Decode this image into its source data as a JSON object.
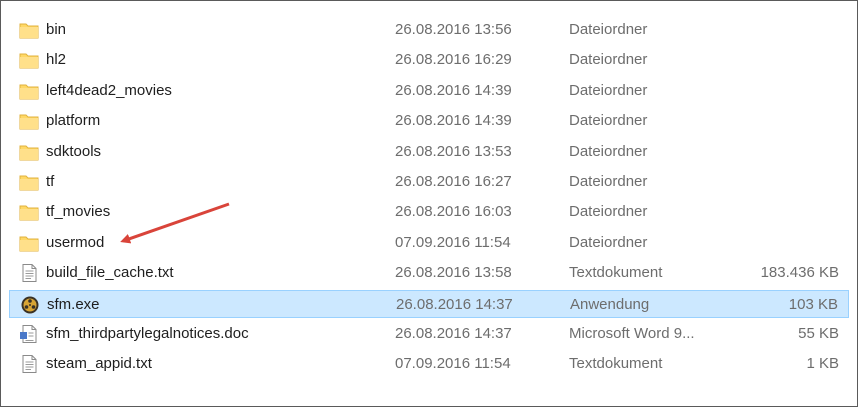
{
  "files": [
    {
      "name": "bin",
      "date": "26.08.2016 13:56",
      "type": "Dateiordner",
      "size": "",
      "icon": "folder-icon"
    },
    {
      "name": "hl2",
      "date": "26.08.2016 16:29",
      "type": "Dateiordner",
      "size": "",
      "icon": "folder-icon"
    },
    {
      "name": "left4dead2_movies",
      "date": "26.08.2016 14:39",
      "type": "Dateiordner",
      "size": "",
      "icon": "folder-icon"
    },
    {
      "name": "platform",
      "date": "26.08.2016 14:39",
      "type": "Dateiordner",
      "size": "",
      "icon": "folder-icon"
    },
    {
      "name": "sdktools",
      "date": "26.08.2016 13:53",
      "type": "Dateiordner",
      "size": "",
      "icon": "folder-icon"
    },
    {
      "name": "tf",
      "date": "26.08.2016 16:27",
      "type": "Dateiordner",
      "size": "",
      "icon": "folder-icon"
    },
    {
      "name": "tf_movies",
      "date": "26.08.2016 16:03",
      "type": "Dateiordner",
      "size": "",
      "icon": "folder-icon"
    },
    {
      "name": "usermod",
      "date": "07.09.2016 11:54",
      "type": "Dateiordner",
      "size": "",
      "icon": "folder-icon"
    },
    {
      "name": "build_file_cache.txt",
      "date": "26.08.2016 13:58",
      "type": "Textdokument",
      "size": "183.436 KB",
      "icon": "text-file-icon"
    },
    {
      "name": "sfm.exe",
      "date": "26.08.2016 14:37",
      "type": "Anwendung",
      "size": "103 KB",
      "icon": "sfm-app-icon",
      "selected": true
    },
    {
      "name": "sfm_thirdpartylegalnotices.doc",
      "date": "26.08.2016 14:37",
      "type": "Microsoft Word 9...",
      "size": "55 KB",
      "icon": "document-file-icon"
    },
    {
      "name": "steam_appid.txt",
      "date": "07.09.2016 11:54",
      "type": "Textdokument",
      "size": "1 KB",
      "icon": "text-file-icon"
    }
  ],
  "colors": {
    "selection_fill": "#cce8ff",
    "selection_border": "#99d1ff",
    "folder": "#ffd866",
    "annotation_arrow": "#d9443a"
  }
}
